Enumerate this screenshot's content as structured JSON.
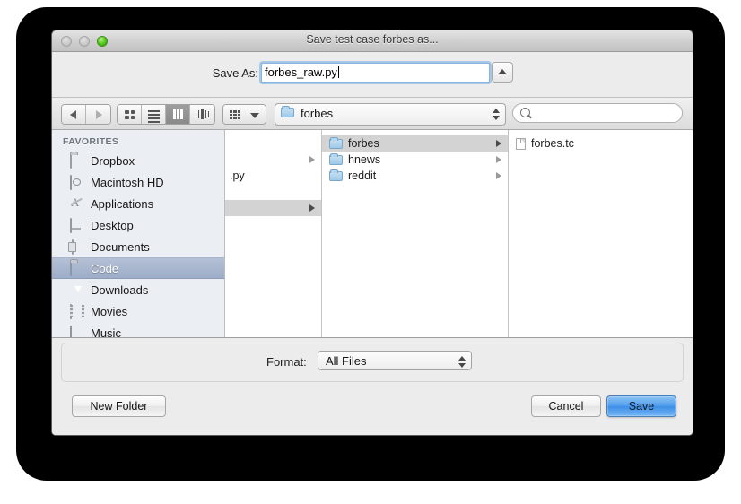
{
  "window": {
    "title": "Save test case forbes as...",
    "traffic_lights": [
      "close-button",
      "minimize-button",
      "zoom-button"
    ]
  },
  "saveas": {
    "label": "Save As:",
    "filename": "forbes_raw.py",
    "placeholder": "",
    "collapse_icon": "triangle-up-icon"
  },
  "toolbar": {
    "back_icon": "arrow-left-icon",
    "forward_icon": "arrow-right-icon",
    "view_modes": [
      {
        "name": "icon-view",
        "icon": "grid-icon",
        "selected": false
      },
      {
        "name": "list-view",
        "icon": "list-icon",
        "selected": false
      },
      {
        "name": "column-view",
        "icon": "columns-icon",
        "selected": true
      },
      {
        "name": "coverflow-view",
        "icon": "coverflow-icon",
        "selected": false
      }
    ],
    "action_icon": "grid-dots-icon",
    "action_caret": "chevron-down-icon",
    "path_label": "forbes",
    "path_icon": "blue-folder-icon",
    "search_placeholder": "",
    "search_value": "",
    "search_icon": "search-icon"
  },
  "sidebar": {
    "header": "FAVORITES",
    "items": [
      {
        "label": "Dropbox",
        "icon": "folder-icon",
        "selected": false
      },
      {
        "label": "Macintosh HD",
        "icon": "harddisk-icon",
        "selected": false
      },
      {
        "label": "Applications",
        "icon": "applications-icon",
        "selected": false
      },
      {
        "label": "Desktop",
        "icon": "desktop-icon",
        "selected": false
      },
      {
        "label": "Documents",
        "icon": "documents-icon",
        "selected": false
      },
      {
        "label": "Code",
        "icon": "folder-icon",
        "selected": true
      },
      {
        "label": "Downloads",
        "icon": "downloads-icon",
        "selected": false
      },
      {
        "label": "Movies",
        "icon": "movies-icon",
        "selected": false
      },
      {
        "label": "Music",
        "icon": "music-icon",
        "selected": false
      }
    ]
  },
  "browser": {
    "columns": [
      {
        "name": "column-1",
        "items": [
          {
            "label": "",
            "icon": "",
            "has_children": true,
            "selected": false
          },
          {
            "label": ".py",
            "icon": "",
            "has_children": false,
            "selected": false
          },
          {
            "label": "",
            "icon": "",
            "has_children": false,
            "selected": false
          },
          {
            "label": "",
            "icon": "",
            "has_children": true,
            "selected": true
          }
        ]
      },
      {
        "name": "column-2",
        "items": [
          {
            "label": "forbes",
            "icon": "blue-folder-icon",
            "has_children": true,
            "selected": true
          },
          {
            "label": "hnews",
            "icon": "blue-folder-icon",
            "has_children": true,
            "selected": false
          },
          {
            "label": "reddit",
            "icon": "blue-folder-icon",
            "has_children": true,
            "selected": false
          }
        ]
      },
      {
        "name": "column-3",
        "items": [
          {
            "label": "forbes.tc",
            "icon": "document-icon",
            "has_children": false,
            "selected": false
          }
        ]
      }
    ]
  },
  "format": {
    "label": "Format:",
    "value": "All Files",
    "options": [
      "All Files"
    ]
  },
  "buttons": {
    "new_folder": "New Folder",
    "cancel": "Cancel",
    "save": "Save"
  },
  "colors": {
    "accent_blue": "#4f9ded",
    "selection_blue": "#9eadc8",
    "window_bg": "#ececec",
    "sidebar_bg": "#ebeef2",
    "folder_blue": "#9fc9e8"
  }
}
